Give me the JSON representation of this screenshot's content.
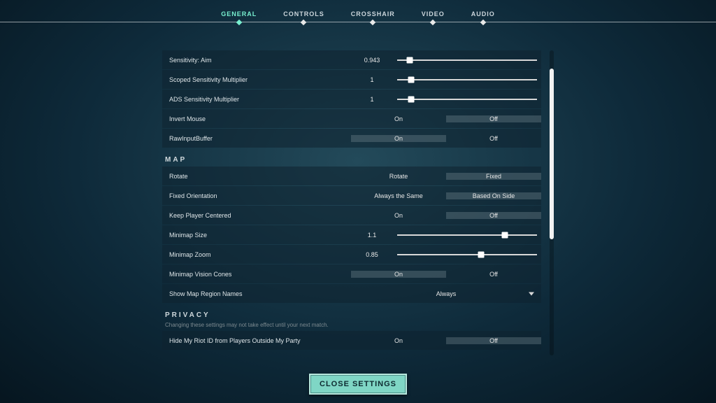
{
  "tabs": [
    "GENERAL",
    "CONTROLS",
    "CROSSHAIR",
    "VIDEO",
    "AUDIO"
  ],
  "active_tab": 0,
  "sensitivity": {
    "aim": {
      "label": "Sensitivity: Aim",
      "value": "0.943",
      "knob_pct": 9
    },
    "scoped": {
      "label": "Scoped Sensitivity Multiplier",
      "value": "1",
      "knob_pct": 10
    },
    "ads": {
      "label": "ADS Sensitivity Multiplier",
      "value": "1",
      "knob_pct": 10
    },
    "invert": {
      "label": "Invert Mouse",
      "on": "On",
      "off": "Off",
      "selected": "off"
    },
    "rawinput": {
      "label": "RawInputBuffer",
      "on": "On",
      "off": "Off",
      "selected": "on"
    }
  },
  "map": {
    "heading": "MAP",
    "rotate": {
      "label": "Rotate",
      "a": "Rotate",
      "b": "Fixed",
      "selected": "b"
    },
    "orient": {
      "label": "Fixed Orientation",
      "a": "Always the Same",
      "b": "Based On Side",
      "selected": "b"
    },
    "centered": {
      "label": "Keep Player Centered",
      "a": "On",
      "b": "Off",
      "selected": "b"
    },
    "size": {
      "label": "Minimap Size",
      "value": "1.1",
      "knob_pct": 77
    },
    "zoom": {
      "label": "Minimap Zoom",
      "value": "0.85",
      "knob_pct": 60
    },
    "cones": {
      "label": "Minimap Vision Cones",
      "a": "On",
      "b": "Off",
      "selected": "a"
    },
    "region": {
      "label": "Show Map Region Names",
      "value": "Always"
    }
  },
  "privacy": {
    "heading": "PRIVACY",
    "note": "Changing these settings may not take effect until your next match.",
    "hideid": {
      "label": "Hide My Riot ID from Players Outside My Party",
      "a": "On",
      "b": "Off",
      "selected": "b"
    }
  },
  "close_label": "CLOSE SETTINGS",
  "scroll": {
    "thumb_top_pct": 6,
    "thumb_height_pct": 56
  }
}
